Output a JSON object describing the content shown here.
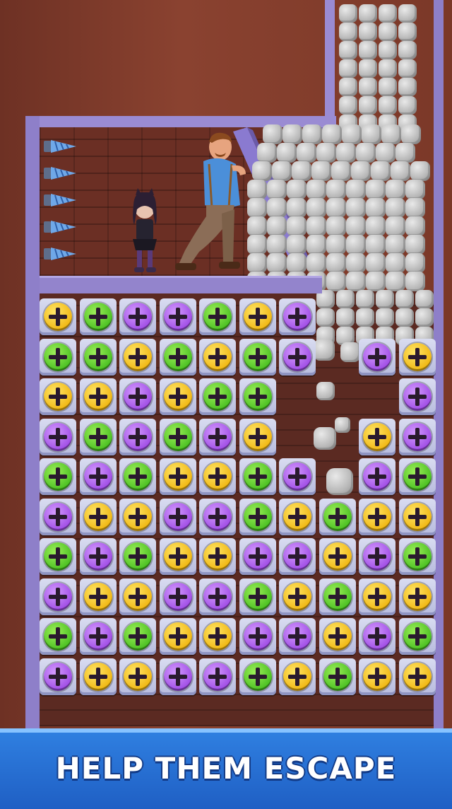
{
  "banner": {
    "text": "HELP THEM ESCAPE"
  },
  "characters": [
    {
      "name": "girl-character",
      "role": "girl"
    },
    {
      "name": "man-character",
      "role": "man"
    }
  ],
  "hazards": {
    "drills": 5,
    "drill_icon": "drill-icon"
  },
  "board": {
    "columns": 10,
    "rows": 10,
    "colors": {
      "yellow": "#f1b814",
      "green": "#4cc123",
      "purple": "#a14fe6"
    },
    "grid": [
      [
        "yellow",
        "green",
        "purple",
        "purple",
        "green",
        "yellow",
        "purple",
        null,
        null,
        null
      ],
      [
        "green",
        "green",
        "yellow",
        "green",
        "yellow",
        "green",
        "purple",
        null,
        "purple",
        "yellow"
      ],
      [
        "yellow",
        "yellow",
        "purple",
        "yellow",
        "green",
        "green",
        null,
        null,
        null,
        "purple"
      ],
      [
        "purple",
        "green",
        "purple",
        "green",
        "purple",
        "yellow",
        null,
        null,
        "yellow",
        "purple"
      ],
      [
        "green",
        "purple",
        "green",
        "yellow",
        "yellow",
        "green",
        "purple",
        null,
        "purple",
        "green"
      ],
      [
        "purple",
        "yellow",
        "yellow",
        "purple",
        "purple",
        "green",
        "yellow",
        "green",
        "yellow",
        "yellow"
      ],
      [
        "green",
        "purple",
        "green",
        "yellow",
        "yellow",
        "purple",
        "purple",
        "yellow",
        "purple",
        "green"
      ],
      [
        "purple",
        "yellow",
        "yellow",
        "purple",
        "purple",
        "green",
        "yellow",
        "green",
        "yellow",
        "yellow"
      ],
      [
        "green",
        "purple",
        "green",
        "yellow",
        "yellow",
        "purple",
        "purple",
        "yellow",
        "purple",
        "green"
      ],
      [
        "purple",
        "yellow",
        "yellow",
        "purple",
        "purple",
        "green",
        "yellow",
        "green",
        "yellow",
        "yellow"
      ]
    ]
  }
}
